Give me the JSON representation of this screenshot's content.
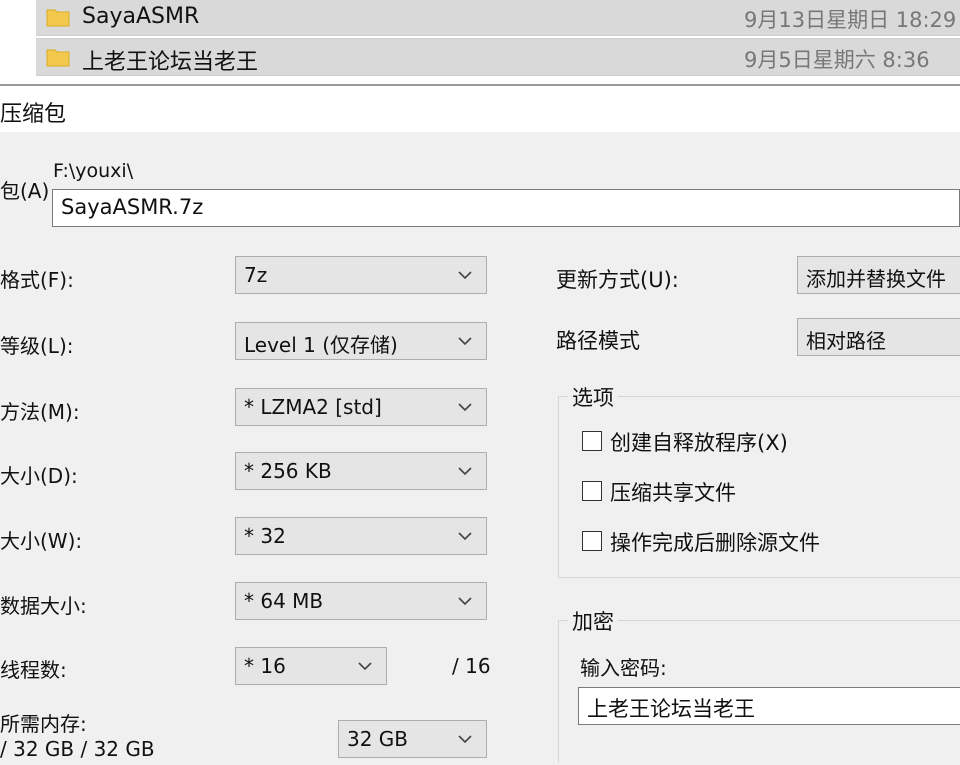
{
  "file_list": {
    "rows": [
      {
        "name": "SayaASMR",
        "date": "9月13日星期日 18:29"
      },
      {
        "name": "上老王论坛当老王",
        "date": "9月5日星期六 8:36"
      }
    ]
  },
  "dialog": {
    "title": "压缩包",
    "archive": {
      "label": "包(A)",
      "path": "F:\\youxi\\",
      "filename": "SayaASMR.7z"
    },
    "left_fields": [
      {
        "label": "格式(F):",
        "value": "7z"
      },
      {
        "label": "等级(L):",
        "value": "Level 1 (仅存储)"
      },
      {
        "label": "方法(M):",
        "value": "* LZMA2 [std]"
      },
      {
        "label": "大小(D):",
        "value": "* 256 KB"
      },
      {
        "label": "大小(W):",
        "value": "* 32"
      },
      {
        "label": "数据大小:",
        "value": "* 64 MB"
      },
      {
        "label": "线程数:",
        "value": "* 16"
      }
    ],
    "thread_max": "/ 16",
    "memory": {
      "label": "所需内存:",
      "usage": "/ 32 GB / 32 GB",
      "value": "32 GB"
    },
    "update_mode": {
      "label": "更新方式(U):",
      "value": "添加并替换文件"
    },
    "path_mode": {
      "label": "路径模式",
      "value": "相对路径"
    },
    "options": {
      "title": "选项",
      "items": [
        {
          "label": "创建自释放程序(X)",
          "checked": false
        },
        {
          "label": "压缩共享文件",
          "checked": false
        },
        {
          "label": "操作完成后删除源文件",
          "checked": false
        }
      ]
    },
    "encryption": {
      "title": "加密",
      "password_label": "输入密码:",
      "password_value": "上老王论坛当老王"
    }
  },
  "colors": {
    "folder": "#f2c94c",
    "dialog_bg": "#f0f0f0",
    "combo_bg": "#e5e5e5",
    "selected_row": "#d9d9d9"
  }
}
